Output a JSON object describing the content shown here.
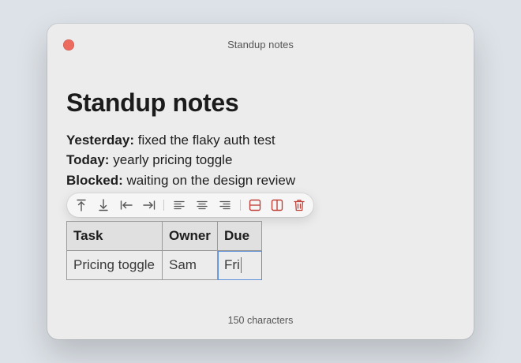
{
  "window": {
    "title": "Standup notes"
  },
  "document": {
    "heading": "Standup notes",
    "lines": [
      {
        "label": "Yesterday:",
        "text": "fixed the flaky auth test"
      },
      {
        "label": "Today:",
        "text": "yearly pricing toggle"
      },
      {
        "label": "Blocked:",
        "text": "waiting on the design review"
      }
    ]
  },
  "table_toolbar": {
    "icons": [
      "move-row-up-icon",
      "move-row-down-icon",
      "move-column-left-icon",
      "move-column-right-icon",
      "align-left-icon",
      "align-center-icon",
      "align-right-icon",
      "add-row-icon",
      "add-column-icon",
      "delete-icon"
    ],
    "delete_color": "#c0433b"
  },
  "table": {
    "headers": [
      "Task",
      "Owner",
      "Due"
    ],
    "rows": [
      [
        "Pricing toggle",
        "Sam",
        "Fri"
      ]
    ]
  },
  "status": {
    "character_count": "150 characters"
  },
  "colors": {
    "close_button": "#ed6a5e",
    "selection_border": "#5b8fd9"
  }
}
